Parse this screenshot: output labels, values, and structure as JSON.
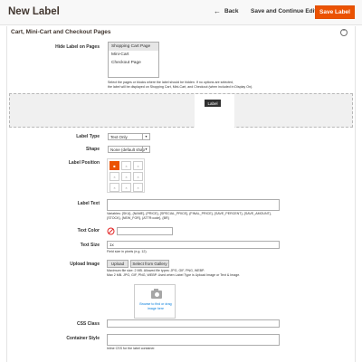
{
  "header": {
    "title": "New Label",
    "back_label": "Back",
    "save_continue_label": "Save and Continue Edit",
    "save_label": "Save Label"
  },
  "section": {
    "title": "Cart, Mini-Cart and Checkout Pages"
  },
  "hide_label": {
    "label": "Hide Label on Pages",
    "options": [
      "Shopping Cart Page",
      "Mini-Cart",
      "Checkout Page"
    ],
    "selected": "Shopping Cart Page",
    "note_line1": "Select the pages or blocks where the label should be hidden. If no options are selected,",
    "note_line2": "the label will be displayed on Shopping Cart, Mini-Cart, and Checkout (when included in Display On)."
  },
  "preview": {
    "tag_text": "Label"
  },
  "label_type": {
    "label": "Label Type",
    "value": "Text Only"
  },
  "shape": {
    "label": "Shape",
    "value": "None (default shap"
  },
  "label_position": {
    "label": "Label Position",
    "selected_index": 0
  },
  "label_text": {
    "label": "Label Text",
    "note_line1": "Variables: {SKU}, {NAME}, {PRICE}, {SPECIAL_PRICE}, {FINAL_PRICE}, {SAVE_PERCENT}, {SAVE_AMOUNT},",
    "note_line2": "{STOCK}, {NEW_FOR}, {ATTR:code}, {BR}"
  },
  "text_color": {
    "label": "Text Color"
  },
  "text_size": {
    "label": "Text Size",
    "value": "1x",
    "note": "Field size in pixels (e.g. 12)."
  },
  "upload_image": {
    "label": "Upload Image",
    "upload_btn": "Upload",
    "gallery_btn": "Select from Gallery",
    "note_line1": "Maximum file size: 2 MB. Allowed file types: JPG, GIF, PNG, WEBP.",
    "note_line2": "Max 2 MB. JPG, GIF, PNG, WEBP. Used when Label Type is Upload Image or Text & Image.",
    "drop_text": "Browse to find or drag image here"
  },
  "css_class": {
    "label": "CSS Class"
  },
  "container_style": {
    "label": "Container Style",
    "note": "Inline CSS for the label container."
  },
  "colors": {
    "accent": "#eb5202",
    "link": "#007bdb"
  },
  "icons": {
    "back": "arrow-left-icon",
    "collapse": "collapse-icon",
    "caret": "chevron-down-icon",
    "camera": "camera-icon",
    "no_color": "no-color-icon"
  }
}
